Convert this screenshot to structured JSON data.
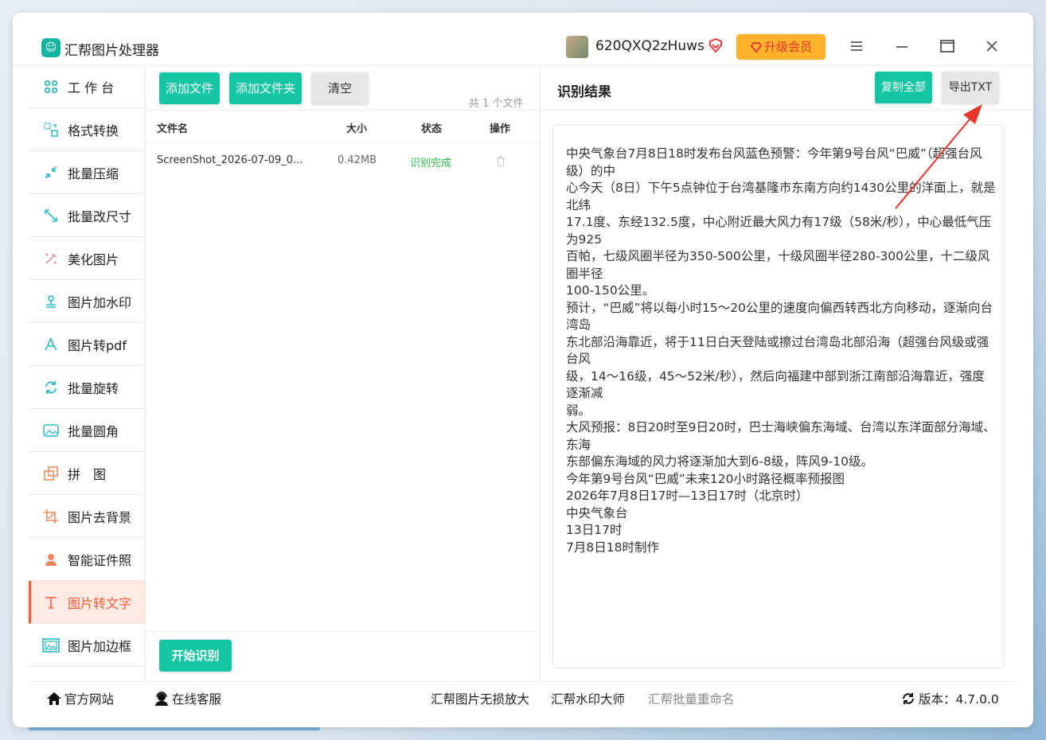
{
  "app": {
    "title": "汇帮图片处理器",
    "logo_glyph": "☺"
  },
  "account": {
    "username": "620QXQ2zHuws",
    "upgrade_label": "升级会员"
  },
  "sidebar": {
    "items": [
      {
        "label": "工 作 台",
        "icon": "grid-icon",
        "active": false
      },
      {
        "label": "格式转换",
        "icon": "format-convert-icon",
        "active": false
      },
      {
        "label": "批量压缩",
        "icon": "compress-icon",
        "active": false
      },
      {
        "label": "批量改尺寸",
        "icon": "resize-icon",
        "active": false
      },
      {
        "label": "美化图片",
        "icon": "beautify-icon",
        "active": false
      },
      {
        "label": "图片加水印",
        "icon": "watermark-icon",
        "active": false
      },
      {
        "label": "图片转pdf",
        "icon": "pdf-icon",
        "active": false
      },
      {
        "label": "批量旋转",
        "icon": "rotate-icon",
        "active": false
      },
      {
        "label": "批量圆角",
        "icon": "rounded-corner-icon",
        "active": false
      },
      {
        "label": "拼　图",
        "icon": "collage-icon",
        "active": false
      },
      {
        "label": "图片去背景",
        "icon": "crop-background-icon",
        "active": false
      },
      {
        "label": "智能证件照",
        "icon": "id-photo-icon",
        "active": false
      },
      {
        "label": "图片转文字",
        "icon": "text-icon",
        "active": true
      },
      {
        "label": "图片加边框",
        "icon": "frame-icon",
        "active": false
      }
    ]
  },
  "files": {
    "add_file_label": "添加文件",
    "add_folder_label": "添加文件夹",
    "clear_label": "清空",
    "count_text": "共 1 个文件",
    "columns": [
      "文件名",
      "大小",
      "状态",
      "操作"
    ],
    "rows": [
      {
        "name": "ScreenShot_2026-07-09_0...",
        "size": "0.42MB",
        "status": "识别完成"
      }
    ],
    "start_label": "开始识别"
  },
  "result": {
    "title": "识别结果",
    "copy_all_label": "复制全部",
    "export_label": "导出TXT",
    "text": "中央气象台7月8日18时发布台风蓝色预警：今年第9号台风“巴威”（超强台风级）的中\n心今天（8日）下午5点钟位于台湾基隆市东南方向约1430公里的洋面上，就是北纬\n17.1度、东经132.5度，中心附近最大风力有17级（58米/秒），中心最低气压为925\n百帕，七级风圈半径为350-500公里，十级风圈半径280-300公里，十二级风圈半径\n100-150公里。\n预计，“巴威”将以每小时15～20公里的速度向偏西转西北方向移动，逐渐向台湾岛\n东北部沿海靠近，将于11日白天登陆或擦过台湾岛北部沿海（超强台风级或强台风\n级，14～16级，45～52米/秒），然后向福建中部到浙江南部沿海靠近，强度逐渐减\n弱。\n大风预报：8日20时至9日20时，巴士海峡偏东海域、台湾以东洋面部分海域、东海\n东部偏东海域的风力将逐渐加大到6-8级，阵风9-10级。\n今年第9号台风“巴威”未来120小时路径概率预报图\n2026年7月8日17时—13日17时（北京时）\n中央气象台\n13日17时\n7月8日18时制作"
  },
  "footer": {
    "website_label": "官方网站",
    "service_label": "在线客服",
    "link1": "汇帮图片无损放大",
    "link2": "汇帮水印大师",
    "link3": "汇帮批量重命名",
    "version_label": "版本：4.7.0.0"
  },
  "colors": {
    "accent_green": "#14c6a4",
    "active_red": "#ff5a3a",
    "upgrade_bg": "#ffb22a",
    "status_green": "#2db84d"
  }
}
